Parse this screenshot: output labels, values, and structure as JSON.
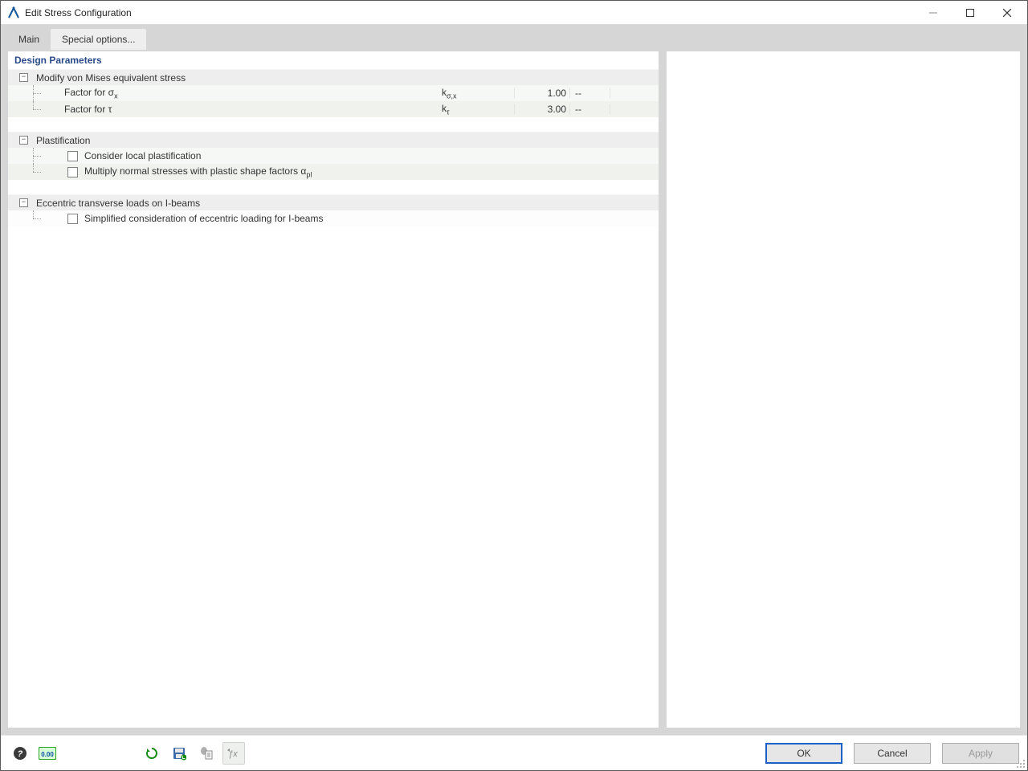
{
  "window": {
    "title": "Edit Stress Configuration",
    "min": "—",
    "max": "□",
    "close": "✕"
  },
  "tabs": {
    "main": "Main",
    "special": "Special options...",
    "active": "special"
  },
  "panel_title": "Design Parameters",
  "groups": {
    "mises": {
      "title": "Modify von Mises equivalent stress",
      "rows": [
        {
          "label": "Factor for σ",
          "label_sub": "x",
          "sym": "k",
          "sym_sub": "σ,x",
          "value": "1.00",
          "unit": "--"
        },
        {
          "label": "Factor for τ",
          "label_sub": "",
          "sym": "k",
          "sym_sub": "τ",
          "value": "3.00",
          "unit": "--"
        }
      ]
    },
    "plast": {
      "title": "Plastification",
      "rows": [
        {
          "label": "Consider local plastification"
        },
        {
          "label": "Multiply normal stresses with plastic shape factors α",
          "label_sub": "pl"
        }
      ]
    },
    "ecc": {
      "title": "Eccentric transverse loads on I-beams",
      "rows": [
        {
          "label": "Simplified consideration of eccentric loading for I-beams"
        }
      ]
    }
  },
  "footer": {
    "ok": "OK",
    "cancel": "Cancel",
    "apply": "Apply"
  },
  "icons": {
    "help": "?",
    "precision": "0.00",
    "refresh": "⟳",
    "save": "💾",
    "copy": "⧉",
    "fx": "ƒx"
  }
}
